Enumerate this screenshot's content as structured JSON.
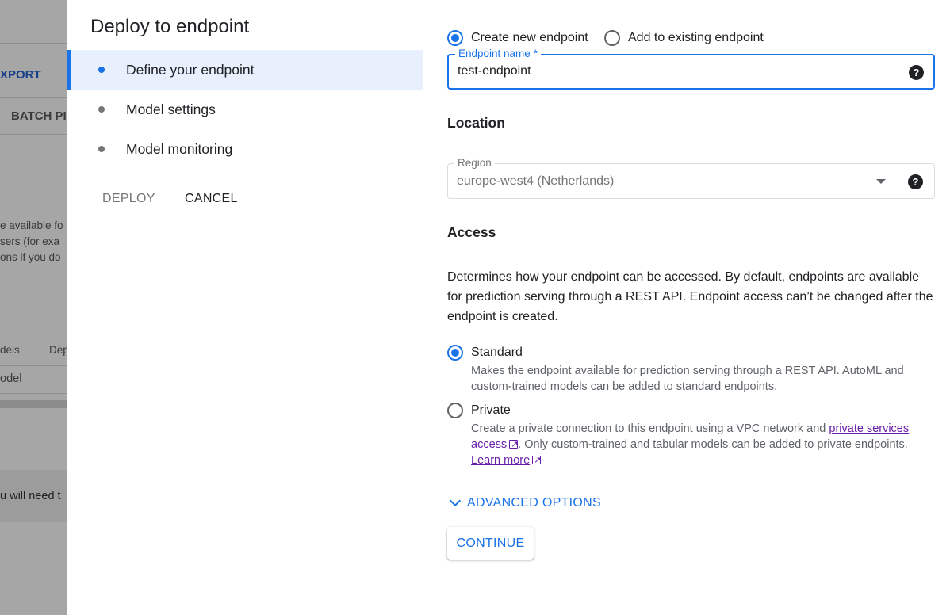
{
  "background": {
    "tab_export": "XPORT",
    "tab_batch": "BATCH PI",
    "para_lines": [
      "e available fo",
      "sers (for exa",
      "ons if you do"
    ],
    "col_models": "dels",
    "col_dep": "Dep",
    "row_model": "odel",
    "footer_text": "u will need t"
  },
  "dialog": {
    "title": "Deploy to endpoint",
    "steps": [
      {
        "label": "Define your endpoint",
        "active": true
      },
      {
        "label": "Model settings",
        "active": false
      },
      {
        "label": "Model monitoring",
        "active": false
      }
    ],
    "deploy_label": "DEPLOY",
    "cancel_label": "CANCEL"
  },
  "form": {
    "endpoint_mode": {
      "create_label": "Create new endpoint",
      "existing_label": "Add to existing endpoint",
      "selected": "create"
    },
    "endpoint_name": {
      "label": "Endpoint name *",
      "value": "test-endpoint"
    },
    "location": {
      "heading": "Location",
      "region_label": "Region",
      "region_value": "europe-west4 (Netherlands)"
    },
    "access": {
      "heading": "Access",
      "description": "Determines how your endpoint can be accessed. By default, endpoints are available for prediction serving through a REST API. Endpoint access can’t be changed after the endpoint is created.",
      "selected": "standard",
      "standard_label": "Standard",
      "standard_desc": "Makes the endpoint available for prediction serving through a REST API. AutoML and custom-trained models can be added to standard endpoints.",
      "private_label": "Private",
      "private_desc_pre": "Create a private connection to this endpoint using a VPC network and",
      "private_link_text": "private services access",
      "private_desc_post": ". Only custom-trained and tabular models can be added to private endpoints.",
      "learn_more": "Learn more"
    },
    "advanced_label": "ADVANCED OPTIONS",
    "continue_label": "CONTINUE"
  },
  "colors": {
    "accent": "#1a73e8",
    "link": "#681da8",
    "active_step_bg": "#e8f0fe"
  },
  "icons": [
    "help-icon",
    "dropdown-arrow-icon",
    "external-link-icon",
    "chevron-down-icon"
  ]
}
